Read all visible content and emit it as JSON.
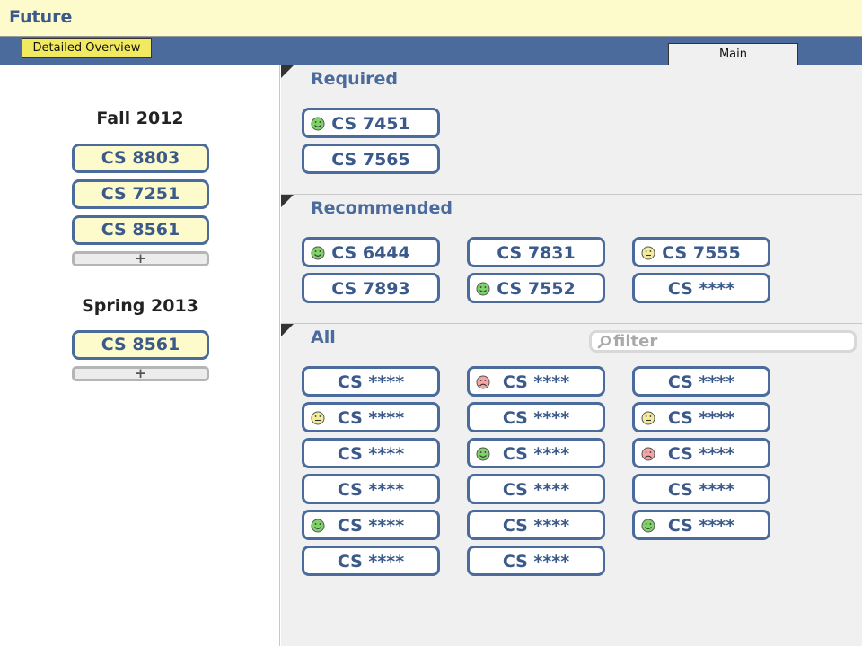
{
  "app": {
    "title": "Future"
  },
  "nav": {
    "detailed_label": "Detailed Overview",
    "main_label": "Main"
  },
  "sidebar": {
    "add_label": "+",
    "terms": [
      {
        "title": "Fall 2012",
        "courses": [
          "CS 8803",
          "CS 7251",
          "CS 8561"
        ]
      },
      {
        "title": "Spring 2013",
        "courses": [
          "CS 8561"
        ]
      }
    ]
  },
  "sections": {
    "required": {
      "title": "Required",
      "courses": [
        {
          "label": "CS 7451",
          "mood": "happy"
        },
        {
          "label": "CS 7565",
          "mood": "none"
        }
      ]
    },
    "recommended": {
      "title": "Recommended",
      "courses": [
        {
          "label": "CS 6444",
          "mood": "happy"
        },
        {
          "label": "CS 7831",
          "mood": "none"
        },
        {
          "label": "CS 7555",
          "mood": "neutral"
        },
        {
          "label": "CS 7893",
          "mood": "none"
        },
        {
          "label": "CS 7552",
          "mood": "happy"
        },
        {
          "label": "CS ****",
          "mood": "none"
        }
      ]
    },
    "all": {
      "title": "All",
      "filter_placeholder": "filter",
      "courses": [
        {
          "label": "CS ****",
          "mood": "none"
        },
        {
          "label": "CS ****",
          "mood": "sad"
        },
        {
          "label": "CS ****",
          "mood": "none"
        },
        {
          "label": "CS ****",
          "mood": "neutral"
        },
        {
          "label": "CS ****",
          "mood": "none"
        },
        {
          "label": "CS ****",
          "mood": "neutral"
        },
        {
          "label": "CS ****",
          "mood": "none"
        },
        {
          "label": "CS ****",
          "mood": "happy"
        },
        {
          "label": "CS ****",
          "mood": "sad"
        },
        {
          "label": "CS ****",
          "mood": "none"
        },
        {
          "label": "CS ****",
          "mood": "none"
        },
        {
          "label": "CS ****",
          "mood": "none"
        },
        {
          "label": "CS ****",
          "mood": "happy"
        },
        {
          "label": "CS ****",
          "mood": "none"
        },
        {
          "label": "CS ****",
          "mood": "happy"
        },
        {
          "label": "CS ****",
          "mood": "none"
        },
        {
          "label": "CS ****",
          "mood": "none"
        }
      ]
    }
  },
  "icons": {
    "happy": "smiley-happy-icon",
    "neutral": "smiley-neutral-icon",
    "sad": "smiley-sad-icon",
    "filter": "search-icon",
    "section_toggle": "collapse-triangle-icon"
  },
  "colors": {
    "happy": "#7fd16a",
    "neutral": "#f3ec9a",
    "sad": "#f4a6a6",
    "accent": "#4a6b9c",
    "slot_fill": "#fdfbcb",
    "nav_button": "#f1ea60"
  }
}
